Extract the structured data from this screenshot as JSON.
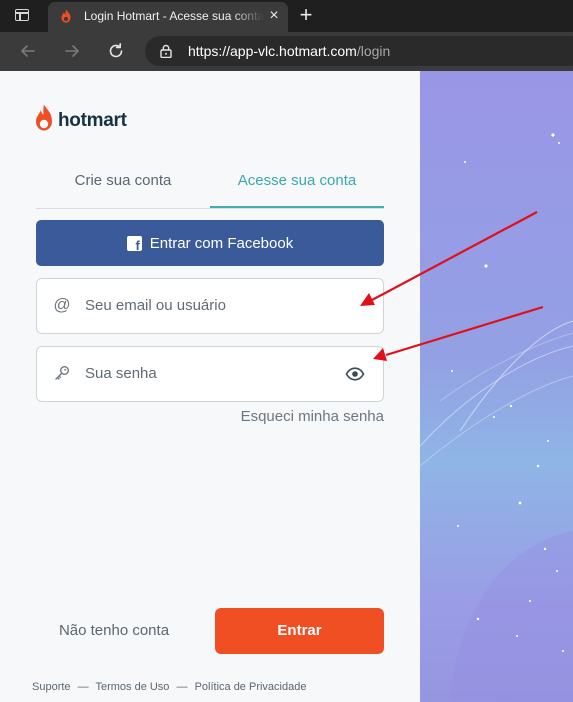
{
  "browser": {
    "tab_title": "Login Hotmart - Acesse sua conta",
    "tab_close": "×",
    "new_tab": "+",
    "url_host": "https://app-vlc.hotmart.com",
    "url_path": "/login"
  },
  "brand": {
    "logo_text": "hotmart",
    "accent_color": "#f04e23",
    "teal_color": "#3bb0b5",
    "facebook_color": "#3b5a9a"
  },
  "auth_tabs": {
    "signup": "Crie sua conta",
    "login": "Acesse sua conta",
    "active": "login"
  },
  "facebook_button": {
    "label": "Entrar com Facebook",
    "icon": "facebook-icon"
  },
  "form": {
    "email": {
      "value": "",
      "placeholder": "Seu email ou usuário",
      "icon": "at-icon"
    },
    "password": {
      "value": "",
      "placeholder": "Sua senha",
      "icon": "key-icon",
      "toggle_icon": "eye-icon"
    },
    "forgot_password": "Esqueci minha senha"
  },
  "actions": {
    "no_account": "Não tenho conta",
    "submit": "Entrar"
  },
  "footer": {
    "support": "Suporte",
    "terms": "Termos de Uso",
    "privacy": "Política de Privacidade",
    "separator": "—"
  }
}
